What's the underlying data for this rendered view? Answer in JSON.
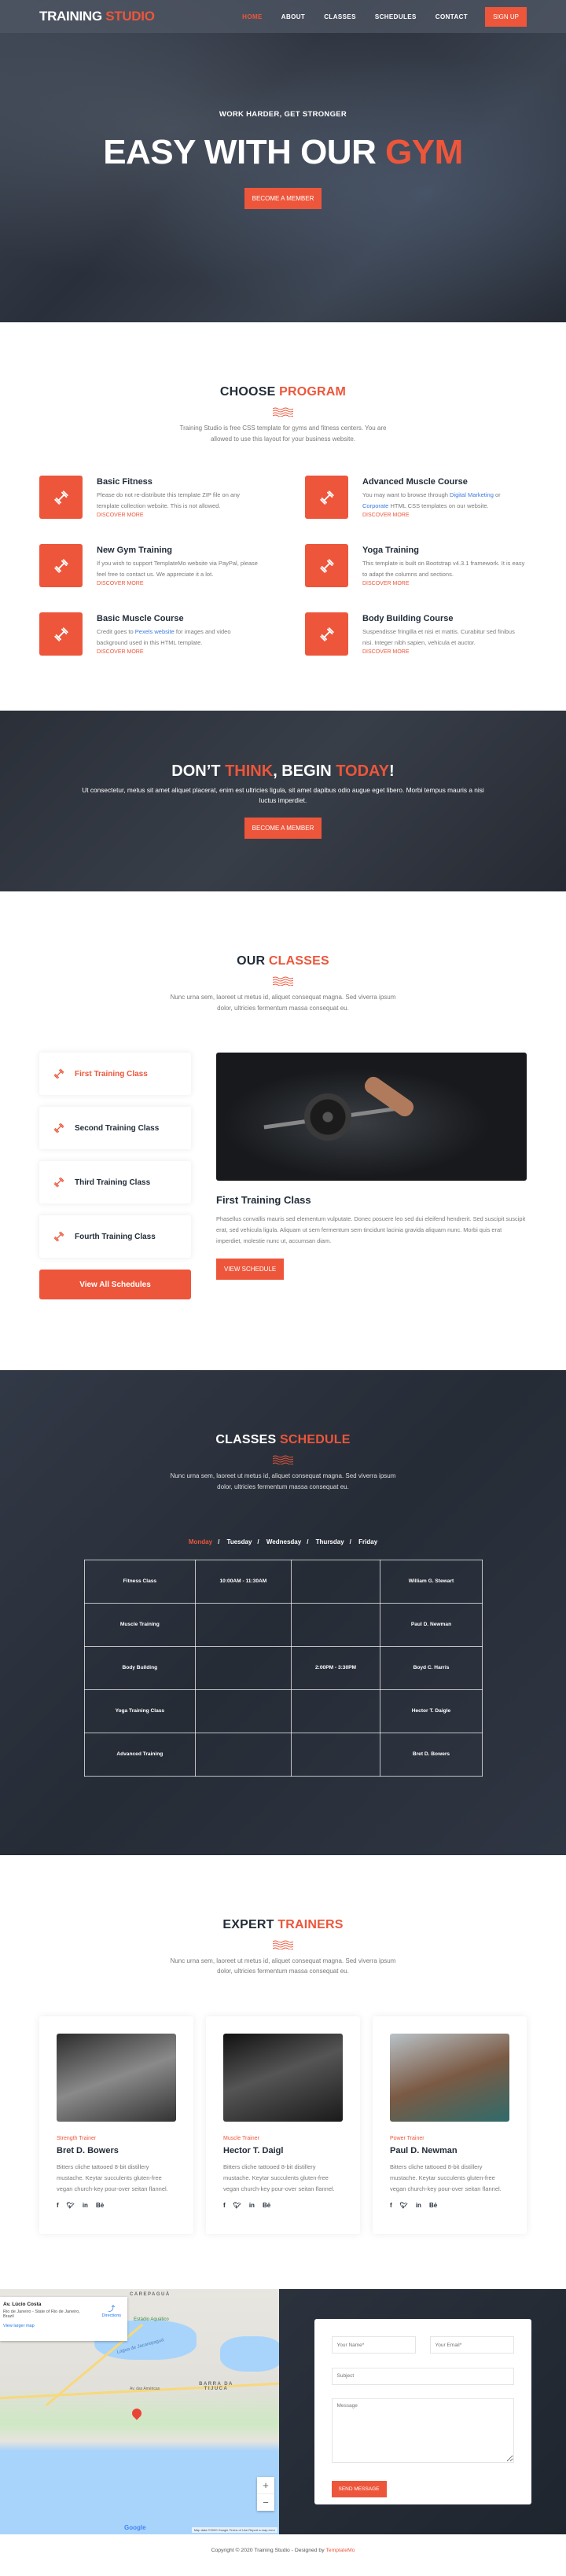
{
  "header": {
    "logo_main": "TRAINING",
    "logo_accent": "STUDIO",
    "nav": [
      "HOME",
      "ABOUT",
      "CLASSES",
      "SCHEDULES",
      "CONTACT"
    ],
    "active_nav": "HOME",
    "signup": "SIGN UP"
  },
  "hero": {
    "subtitle": "WORK HARDER, GET STRONGER",
    "title_main": "EASY WITH OUR ",
    "title_accent": "GYM",
    "button": "BECOME A MEMBER"
  },
  "programs": {
    "title_main": "CHOOSE ",
    "title_accent": "PROGRAM",
    "description": "Training Studio is free CSS template for gyms and fitness centers. You are allowed to use this layout for your business website.",
    "more_label": "DISCOVER MORE",
    "items": [
      {
        "title": "Basic Fitness",
        "text": "Please do not re-distribute this template ZIP file on any template collection website. This is not allowed."
      },
      {
        "title": "Advanced Muscle Course",
        "text_pre": "You may want to browse through ",
        "link1": "Digital Marketing",
        "text_mid": " or ",
        "link2": "Corporate",
        "text_post": " HTML CSS templates on our website."
      },
      {
        "title": "New Gym Training",
        "text": "If you wish to support TemplateMo website via PayPal, please feel free to contact us. We appreciate it a lot."
      },
      {
        "title": "Yoga Training",
        "text": "This template is built on Bootstrap v4.3.1 framework. It is easy to adapt the columns and sections."
      },
      {
        "title": "Basic Muscle Course",
        "text_pre": "Credit goes to ",
        "link1": "Pexels website",
        "text_post": " for images and video background used in this HTML template."
      },
      {
        "title": "Body Building Course",
        "text": "Suspendisse fringilla et nisi et mattis. Curabitur sed finibus nisi. Integer nibh sapien, vehicula et auctor."
      }
    ]
  },
  "cta": {
    "t1": "DON’T ",
    "t2": "THINK",
    ",t3": "",
    "t3": ", BEGIN ",
    "t4": "TODAY",
    "t5": "!",
    "text": "Ut consectetur, metus sit amet aliquet placerat, enim est ultricies ligula, sit amet dapibus odio augue eget libero. Morbi tempus mauris a nisi luctus imperdiet.",
    "button": "BECOME A MEMBER"
  },
  "classes": {
    "title_main": "OUR ",
    "title_accent": "CLASSES",
    "description": "Nunc urna sem, laoreet ut metus id, aliquet consequat magna. Sed viverra ipsum dolor, ultricies fermentum massa consequat eu.",
    "tabs": [
      "First Training Class",
      "Second Training Class",
      "Third Training Class",
      "Fourth Training Class"
    ],
    "active_tab": 0,
    "view_all": "View All Schedules",
    "detail_title": "First Training Class",
    "detail_text": "Phasellus convallis mauris sed elementum vulputate. Donec posuere leo sed dui eleifend hendrerit. Sed suscipit suscipit erat, sed vehicula ligula. Aliquam ut sem fermentum sem tincidunt lacinia gravida aliquam nunc. Morbi quis erat imperdiet, molestie nunc ut, accumsan diam.",
    "detail_button": "VIEW SCHEDULE"
  },
  "schedule": {
    "title_main": "CLASSES ",
    "title_accent": "SCHEDULE",
    "description": "Nunc urna sem, laoreet ut metus id, aliquet consequat magna. Sed viverra ipsum dolor, ultricies fermentum massa consequat eu.",
    "days": [
      "Monday",
      "Tuesday",
      "Wednesday",
      "Thursday",
      "Friday"
    ],
    "active_day": "Monday",
    "rows": [
      [
        "Fitness Class",
        "10:00AM - 11:30AM",
        "",
        "William G. Stewart"
      ],
      [
        "Muscle Training",
        "",
        "",
        "Paul D. Newman"
      ],
      [
        "Body Building",
        "",
        "2:00PM - 3:30PM",
        "Boyd C. Harris"
      ],
      [
        "Yoga Training Class",
        "",
        "",
        "Hector T. Daigle"
      ],
      [
        "Advanced Training",
        "",
        "",
        "Bret D. Bowers"
      ]
    ]
  },
  "trainers": {
    "title_main": "EXPERT ",
    "title_accent": "TRAINERS",
    "description": "Nunc urna sem, laoreet ut metus id, aliquet consequat magna. Sed viverra ipsum dolor, ultricies fermentum massa consequat eu.",
    "items": [
      {
        "role": "Strength Trainer",
        "name": "Bret D. Bowers",
        "text": "Bitters cliche tattooed 8-bit distillery mustache. Keytar succulents gluten-free vegan church-key pour-over seitan flannel."
      },
      {
        "role": "Muscle Trainer",
        "name": "Hector T. Daigl",
        "text": "Bitters cliche tattooed 8-bit distillery mustache. Keytar succulents gluten-free vegan church-key pour-over seitan flannel."
      },
      {
        "role": "Power Trainer",
        "name": "Paul D. Newman",
        "text": "Bitters cliche tattooed 8-bit distillery mustache. Keytar succulents gluten-free vegan church-key pour-over seitan flannel."
      }
    ],
    "social": [
      "f",
      "♥",
      "in",
      "Bė"
    ]
  },
  "map": {
    "place": "Av. Lúcio Costa",
    "address": "Rio de Janeiro - State of Rio de Janeiro, Brazil",
    "directions": "Directions",
    "view_larger": "View larger map",
    "labels": [
      "CAREPAGUÁ",
      "BARRA DA TIJUCA",
      "Estádio Aquático",
      "Lagoa de Jacarepaguá",
      "Av. das Américas"
    ],
    "zoom_in": "+",
    "zoom_out": "−",
    "google": "Google",
    "footer": "Map data ©2020 Google   Terms of Use   Report a map error"
  },
  "contact": {
    "name_placeholder": "Your Name*",
    "email_placeholder": "Your Email*",
    "subject_placeholder": "Subject",
    "message_placeholder": "Message",
    "button": "SEND MESSAGE"
  },
  "footer": {
    "text": "Copyright © 2020 Training Studio - Designed by ",
    "link": "TemplateMo"
  }
}
